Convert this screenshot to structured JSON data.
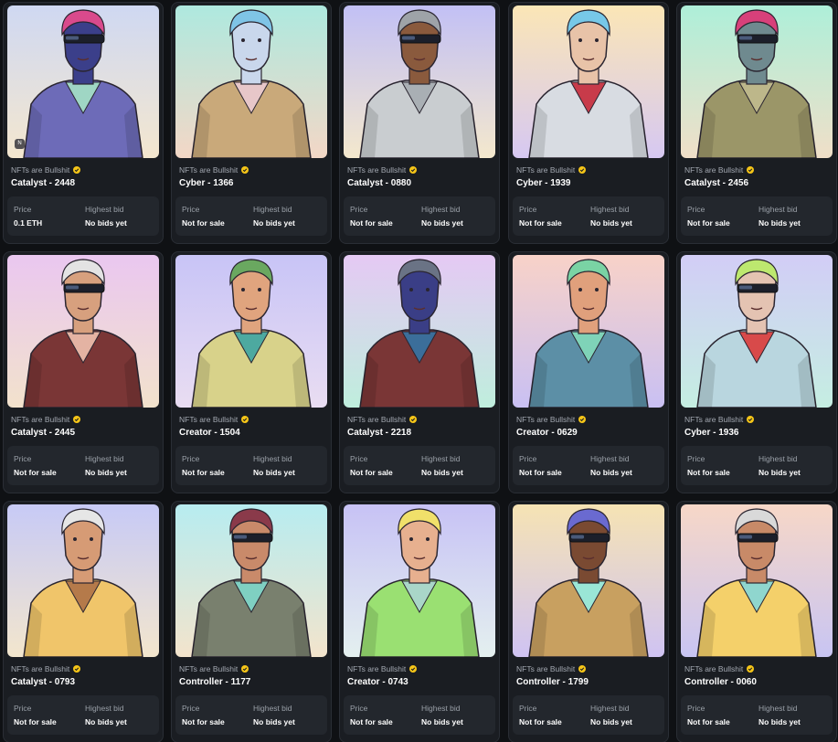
{
  "labels": {
    "price": "Price",
    "highest_bid": "Highest bid"
  },
  "collection": "NFTs are Bullshit",
  "badge_text": "N",
  "cards": [
    {
      "title": "Catalyst - 2448",
      "price": "0.1 ETH",
      "bid": "No bids yet",
      "bg": [
        "#cfd8f2",
        "#f4e7cf"
      ],
      "skin": "#3b3f8a",
      "hair": "#d94a8c",
      "outfit": "#6d6bb8",
      "accent": "#9fd6c4",
      "glasses": true
    },
    {
      "title": "Cyber - 1366",
      "price": "Not for sale",
      "bid": "No bids yet",
      "bg": [
        "#aee9df",
        "#f3d7c6"
      ],
      "skin": "#c9d7ec",
      "hair": "#7fc4e6",
      "outfit": "#c9a97a",
      "accent": "#e7c7c9",
      "glasses": false
    },
    {
      "title": "Catalyst - 0880",
      "price": "Not for sale",
      "bid": "No bids yet",
      "bg": [
        "#c2c0f5",
        "#f4e8cd"
      ],
      "skin": "#8a5a3d",
      "hair": "#9ea3a8",
      "outfit": "#c9cdd0",
      "accent": "#a9afb4",
      "glasses": true
    },
    {
      "title": "Cyber - 1939",
      "price": "Not for sale",
      "bid": "No bids yet",
      "bg": [
        "#fbe6b6",
        "#d6c8f2"
      ],
      "skin": "#e8c3a8",
      "hair": "#77c8e8",
      "outfit": "#d8dce2",
      "accent": "#c83b4a",
      "glasses": false
    },
    {
      "title": "Catalyst - 2456",
      "price": "Not for sale",
      "bid": "No bids yet",
      "bg": [
        "#aeefd9",
        "#f0dfc8"
      ],
      "skin": "#6f8a8f",
      "hair": "#d8407a",
      "outfit": "#9b9668",
      "accent": "#bdb78a",
      "glasses": true
    },
    {
      "title": "Catalyst - 2445",
      "price": "Not for sale",
      "bid": "No bids yet",
      "bg": [
        "#eac7f0",
        "#f2e2cc"
      ],
      "skin": "#d7a07e",
      "hair": "#e3e3e3",
      "outfit": "#7a3636",
      "accent": "#e4b3a3",
      "glasses": true
    },
    {
      "title": "Creator - 1504",
      "price": "Not for sale",
      "bid": "No bids yet",
      "bg": [
        "#c8c4f6",
        "#e9ddf2"
      ],
      "skin": "#e0a47e",
      "hair": "#6aa860",
      "outfit": "#d8d28a",
      "accent": "#4da9a0",
      "glasses": false
    },
    {
      "title": "Catalyst - 2218",
      "price": "Not for sale",
      "bid": "No bids yet",
      "bg": [
        "#e5c9f4",
        "#bfeedd"
      ],
      "skin": "#3a3e86",
      "hair": "#6a7385",
      "outfit": "#7a3636",
      "accent": "#3b6e9a",
      "glasses": false
    },
    {
      "title": "Creator - 0629",
      "price": "Not for sale",
      "bid": "No bids yet",
      "bg": [
        "#f8d2c8",
        "#c9c0f3"
      ],
      "skin": "#e0a07c",
      "hair": "#7ad3a4",
      "outfit": "#5c8fa6",
      "accent": "#7fd3b8",
      "glasses": false
    },
    {
      "title": "Cyber - 1936",
      "price": "Not for sale",
      "bid": "No bids yet",
      "bg": [
        "#d2cdf6",
        "#c5eee2"
      ],
      "skin": "#e4c3b2",
      "hair": "#bde86f",
      "outfit": "#b9d6df",
      "accent": "#d84a4a",
      "glasses": true
    },
    {
      "title": "Catalyst - 0793",
      "price": "Not for sale",
      "bid": "No bids yet",
      "bg": [
        "#c7caf6",
        "#f3e6cd"
      ],
      "skin": "#d69b75",
      "hair": "#e6e6e6",
      "outfit": "#f0c56a",
      "accent": "#b57a4a",
      "glasses": false
    },
    {
      "title": "Controller - 1177",
      "price": "Not for sale",
      "bid": "No bids yet",
      "bg": [
        "#b7ecf0",
        "#f3e4cc"
      ],
      "skin": "#c98a6a",
      "hair": "#8a3a4a",
      "outfit": "#79806e",
      "accent": "#7fd0c2",
      "glasses": true
    },
    {
      "title": "Creator - 0743",
      "price": "Not for sale",
      "bid": "No bids yet",
      "bg": [
        "#c7c2f5",
        "#e4f0ef"
      ],
      "skin": "#e7b08f",
      "hair": "#f0e06a",
      "outfit": "#9ae072",
      "accent": "#a9d6c8",
      "glasses": false
    },
    {
      "title": "Controller - 1799",
      "price": "Not for sale",
      "bid": "No bids yet",
      "bg": [
        "#f6e3b3",
        "#cfc3f3"
      ],
      "skin": "#7a4a32",
      "hair": "#6a6ad0",
      "outfit": "#c8a060",
      "accent": "#9ae6d6",
      "glasses": true
    },
    {
      "title": "Controller - 0060",
      "price": "Not for sale",
      "bid": "No bids yet",
      "bg": [
        "#f7d7c7",
        "#c8c5f3"
      ],
      "skin": "#c88a68",
      "hair": "#d9d9d9",
      "outfit": "#f4d06a",
      "accent": "#8fd6ce",
      "glasses": true
    }
  ]
}
